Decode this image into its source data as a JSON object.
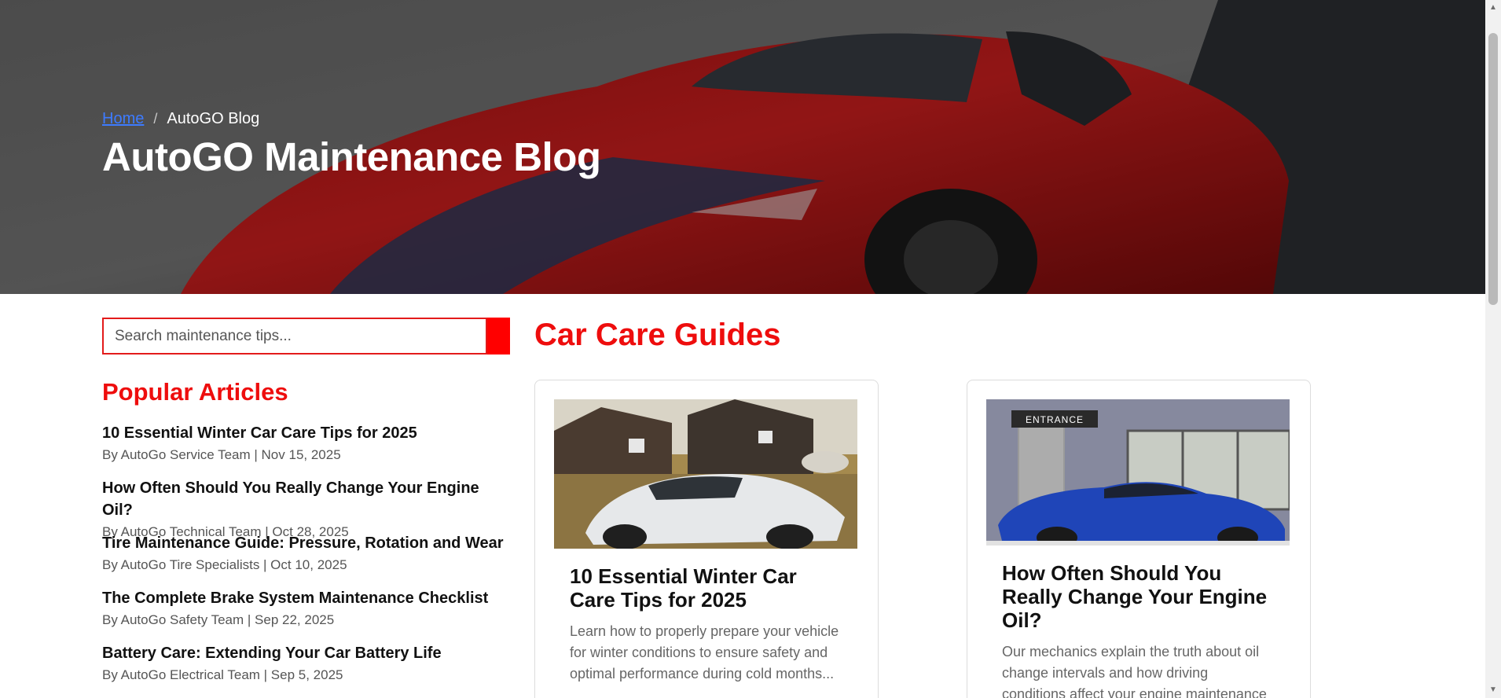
{
  "hero": {
    "breadcrumb": {
      "home": "Home",
      "separator": "/",
      "current": "AutoGO Blog"
    },
    "title": "AutoGO Maintenance Blog"
  },
  "search": {
    "placeholder": "Search maintenance tips..."
  },
  "popular": {
    "heading": "Popular Articles",
    "items": [
      {
        "title": "10 Essential Winter Car Care Tips for 2025",
        "meta": "By AutoGo Service Team | Nov 15, 2025"
      },
      {
        "title": "How Often Should You Really Change Your Engine Oil?",
        "meta": "By AutoGo Technical Team | Oct 28, 2025"
      },
      {
        "title": "Tire Maintenance Guide: Pressure, Rotation and Wear",
        "meta": "By AutoGo Tire Specialists | Oct 10, 2025"
      },
      {
        "title": "The Complete Brake System Maintenance Checklist",
        "meta": "By AutoGo Safety Team | Sep 22, 2025"
      },
      {
        "title": "Battery Care: Extending Your Car Battery Life",
        "meta": "By AutoGo Electrical Team | Sep 5, 2025"
      }
    ]
  },
  "main": {
    "heading": "Car Care Guides",
    "cards": [
      {
        "title": "10 Essential Winter Car Care Tips for 2025",
        "excerpt": "Learn how to properly prepare your vehicle for winter conditions to ensure safety and optimal performance during cold months..."
      },
      {
        "title": "How Often Should You Really Change Your Engine Oil?",
        "excerpt": "Our mechanics explain the truth about oil change intervals and how driving conditions affect your engine maintenance schedule...",
        "image_sign": "ENTRANCE"
      }
    ]
  },
  "colors": {
    "accent": "#ee0d0d",
    "button": "#ff0000",
    "link": "#3d7bff"
  }
}
